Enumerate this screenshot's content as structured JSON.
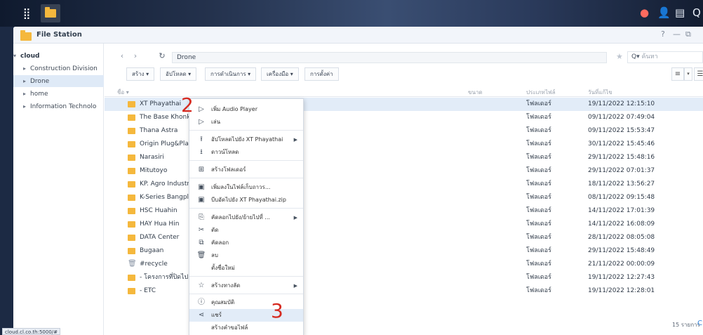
{
  "window": {
    "title": "File Station",
    "controls": [
      "?",
      "—",
      "⧉"
    ]
  },
  "sidebar": {
    "root": "cloud",
    "items": [
      "Construction Division",
      "Drone",
      "home",
      "Information Technolo"
    ]
  },
  "path": {
    "current": "Drone",
    "search_placeholder": "ค้นหา"
  },
  "toolbar": {
    "create": "สร้าง ▾",
    "upload": "อัปโหลด ▾",
    "action": "การดำเนินการ ▾",
    "tools": "เครื่องมือ ▾",
    "settings": "การตั้งค่า"
  },
  "columns": {
    "name": "ชื่อ ▾",
    "size": "ขนาด",
    "type": "ประเภทไฟล์",
    "modified": "วันที่แก้ไข"
  },
  "files": [
    {
      "name": "XT Phayathai",
      "type": "โฟลเดอร์",
      "modified": "19/11/2022 12:15:10"
    },
    {
      "name": "The Base Khonkaen",
      "type": "โฟลเดอร์",
      "modified": "09/11/2022 07:49:04"
    },
    {
      "name": "Thana Astra",
      "type": "โฟลเดอร์",
      "modified": "09/11/2022 15:53:47"
    },
    {
      "name": "Origin Plug&Play Nont",
      "type": "โฟลเดอร์",
      "modified": "30/11/2022 15:45:46"
    },
    {
      "name": "Narasiri",
      "type": "โฟลเดอร์",
      "modified": "29/11/2022 15:48:16"
    },
    {
      "name": "Mitutoyo",
      "type": "โฟลเดอร์",
      "modified": "29/11/2022 07:01:37"
    },
    {
      "name": "KP. Agro Industry Kor",
      "type": "โฟลเดอร์",
      "modified": "18/11/2022 13:56:27"
    },
    {
      "name": "K-Series Bangplee",
      "type": "โฟลเดอร์",
      "modified": "08/11/2022 09:15:48"
    },
    {
      "name": "HSC Huahin",
      "type": "โฟลเดอร์",
      "modified": "14/11/2022 17:01:39"
    },
    {
      "name": "HAY Hua Hin",
      "type": "โฟลเดอร์",
      "modified": "14/11/2022 16:08:09"
    },
    {
      "name": "DATA Center",
      "type": "โฟลเดอร์",
      "modified": "28/11/2022 08:05:08"
    },
    {
      "name": "Bugaan",
      "type": "โฟลเดอร์",
      "modified": "29/11/2022 15:48:49"
    },
    {
      "name": "#recycle",
      "type": "โฟลเดอร์",
      "modified": "21/11/2022 00:00:09"
    },
    {
      "name": "- โครงการที่ปิดไปแล้ว",
      "type": "โฟลเดอร์",
      "modified": "19/11/2022 12:27:43"
    },
    {
      "name": "- ETC",
      "type": "โฟลเดอร์",
      "modified": "19/11/2022 12:28:01"
    }
  ],
  "footer": {
    "count": "15 รายการ"
  },
  "status_url": "cloud.cl.co.th:5000/#",
  "context_menu": {
    "play_audio": "เพิ่ม Audio Player",
    "play": "เล่น",
    "upload_to": "อัปโหลดไปยัง XT Phayathai",
    "download": "ดาวน์โหลด",
    "create_folder": "สร้างโฟลเดอร์",
    "add_archive": "เพิ่มลงในไฟล์เก็บถาวร...",
    "compress_to": "บีบอัดไปยัง XT Phayathai.zip",
    "copy_move": "คัดลอกไปยัง/ย้ายไปที่ ...",
    "cut": "ตัด",
    "copy": "คัดลอก",
    "delete": "ลบ",
    "rename": "ตั้งชื่อใหม่",
    "create_shortcut": "สร้างทางลัด",
    "properties": "คุณสมบัติ",
    "share": "แชร์",
    "file_request": "สร้างคำขอไฟล์"
  },
  "annotations": {
    "step2": "2",
    "step3": "3"
  },
  "colors": {
    "folder": "#f5b83d",
    "selection": "#e2ecf8",
    "annotation": "#d62a20"
  }
}
